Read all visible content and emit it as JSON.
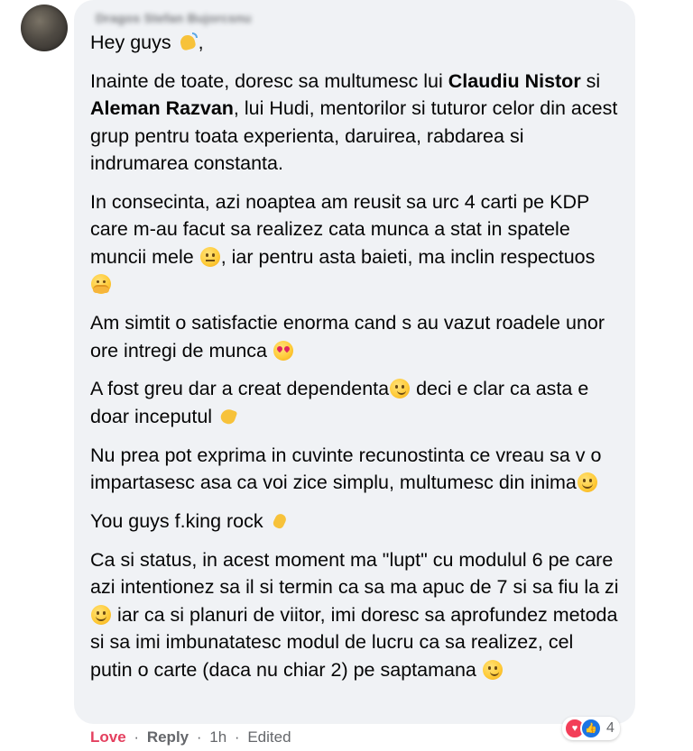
{
  "comment": {
    "author_name": "Dragos Stefan Bujorcsnu",
    "paragraphs": [
      {
        "segments": [
          {
            "text": "Hey guys "
          },
          {
            "emoji": "waving-hand-icon"
          },
          {
            "text": ","
          }
        ]
      },
      {
        "segments": [
          {
            "text": "Inainte de toate, doresc sa multumesc lui "
          },
          {
            "bold": "Claudiu Nistor"
          },
          {
            "text": " si "
          },
          {
            "bold": "Aleman Razvan"
          },
          {
            "text": ", lui Hudi, mentorilor si tuturor celor din acest grup pentru toata experienta, daruirea, rabdarea si indrumarea constanta."
          }
        ]
      },
      {
        "segments": [
          {
            "text": "In consecinta, azi noaptea am reusit sa urc 4 carti pe KDP care m-au facut sa realizez cata munca a stat in spatele muncii mele "
          },
          {
            "emoji": "neutral-face-icon"
          },
          {
            "text": ", iar pentru asta baieti, ma inclin respectuos "
          },
          {
            "emoji": "hugging-face-icon"
          }
        ]
      },
      {
        "segments": [
          {
            "text": "Am simtit o satisfactie enorma cand s au vazut roadele unor ore intregi de munca "
          },
          {
            "emoji": "heart-eyes-icon"
          }
        ]
      },
      {
        "segments": [
          {
            "text": "A fost greu dar a creat dependenta"
          },
          {
            "emoji": "smirk-face-icon"
          },
          {
            "text": " deci e clar ca asta e doar inceputul "
          },
          {
            "emoji": "flexed-biceps-icon"
          }
        ]
      },
      {
        "segments": [
          {
            "text": "Nu prea pot exprima in cuvinte recunostinta ce vreau sa v o impartasesc asa ca voi zice simplu, multumesc din inima"
          },
          {
            "emoji": "blush-face-icon"
          }
        ]
      },
      {
        "segments": [
          {
            "text": "You guys f.king rock "
          },
          {
            "emoji": "rock-hand-icon"
          }
        ]
      },
      {
        "segments": [
          {
            "text": "Ca si status, in acest moment ma \"lupt\" cu modulul 6 pe care azi intentionez sa il si termin ca sa ma apuc de 7 si sa fiu la zi "
          },
          {
            "emoji": "smile-face-icon"
          },
          {
            "text": " iar ca si planuri de viitor, imi doresc sa aprofundez metoda si sa imi imbunatatesc modul de lucru ca sa realizez, cel putin o carte (daca nu chiar 2) pe saptamana "
          },
          {
            "emoji": "smirk-face-icon"
          }
        ]
      }
    ]
  },
  "footer": {
    "love_label": "Love",
    "separator": "·",
    "reply_label": "Reply",
    "time": "1h",
    "edited_label": "Edited"
  },
  "reactions": {
    "icons": [
      "love-reaction-icon",
      "like-reaction-icon"
    ],
    "count": "4"
  },
  "colors": {
    "bubble_bg": "#f0f2f5",
    "love_red": "#e4405f",
    "meta_gray": "#65676b",
    "like_blue": "#1b74e4"
  }
}
